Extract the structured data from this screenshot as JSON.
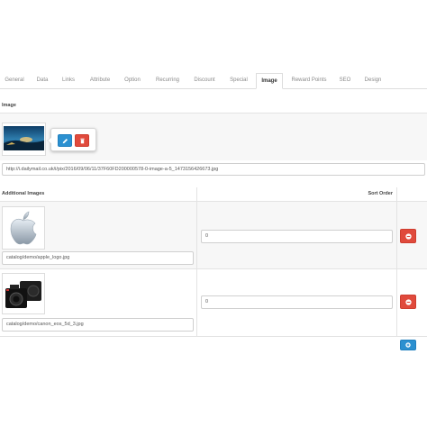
{
  "tabs": [
    {
      "label": "General",
      "active": false
    },
    {
      "label": "Data",
      "active": false
    },
    {
      "label": "Links",
      "active": false
    },
    {
      "label": "Attribute",
      "active": false
    },
    {
      "label": "Option",
      "active": false
    },
    {
      "label": "Recurring",
      "active": false
    },
    {
      "label": "Discount",
      "active": false
    },
    {
      "label": "Special",
      "active": false
    },
    {
      "label": "Image",
      "active": true
    },
    {
      "label": "Reward Points",
      "active": false
    },
    {
      "label": "SEO",
      "active": false
    },
    {
      "label": "Design",
      "active": false
    }
  ],
  "image_section": {
    "heading": "Image",
    "image_url": "http://i.dailymail.co.uk/i/pix/2016/09/06/11/37F60FD200000578-0-image-a-5_1473156426673.jpg",
    "thumbnail_icon": "landscape-photo-icon",
    "edit_icon": "pencil-icon",
    "clear_icon": "trash-icon"
  },
  "additional_images": {
    "heading_image": "Additional Images",
    "heading_sort": "Sort Order",
    "rows": [
      {
        "path": "catalog/demo/apple_logo.jpg",
        "sort_order": "0",
        "thumbnail_icon": "apple-logo-icon",
        "remove_icon": "minus-circle-icon"
      },
      {
        "path": "catalog/demo/canon_eos_5d_3.jpg",
        "sort_order": "0",
        "thumbnail_icon": "camera-icon",
        "remove_icon": "minus-circle-icon"
      }
    ],
    "add_icon": "plus-circle-icon"
  },
  "colors": {
    "primary": "#2b90d0",
    "danger": "#e04a3c"
  }
}
